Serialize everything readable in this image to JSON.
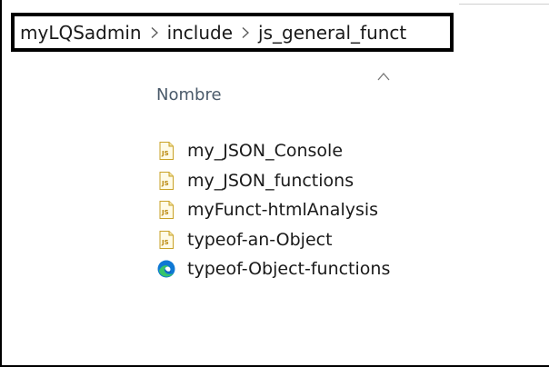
{
  "breadcrumb": {
    "items": [
      "myLQSadmin",
      "include",
      "js_general_funct"
    ],
    "separator_icon": "chevron-right-icon"
  },
  "file_list": {
    "sort_indicator_icon": "sort-ascending-caret-icon",
    "column_header": "Nombre",
    "files": [
      {
        "name": "my_JSON_Console",
        "icon": "js-file-icon"
      },
      {
        "name": "my_JSON_functions",
        "icon": "js-file-icon"
      },
      {
        "name": "myFunct-htmlAnalysis",
        "icon": "js-file-icon"
      },
      {
        "name": "typeof-an-Object",
        "icon": "js-file-icon"
      },
      {
        "name": "typeof-Object-functions",
        "icon": "edge-browser-icon"
      }
    ]
  },
  "colors": {
    "js_icon_accent": "#d9a400",
    "edge_blue": "#0f78d4",
    "edge_green": "#36c46a",
    "header_text": "#4a5a6a"
  }
}
